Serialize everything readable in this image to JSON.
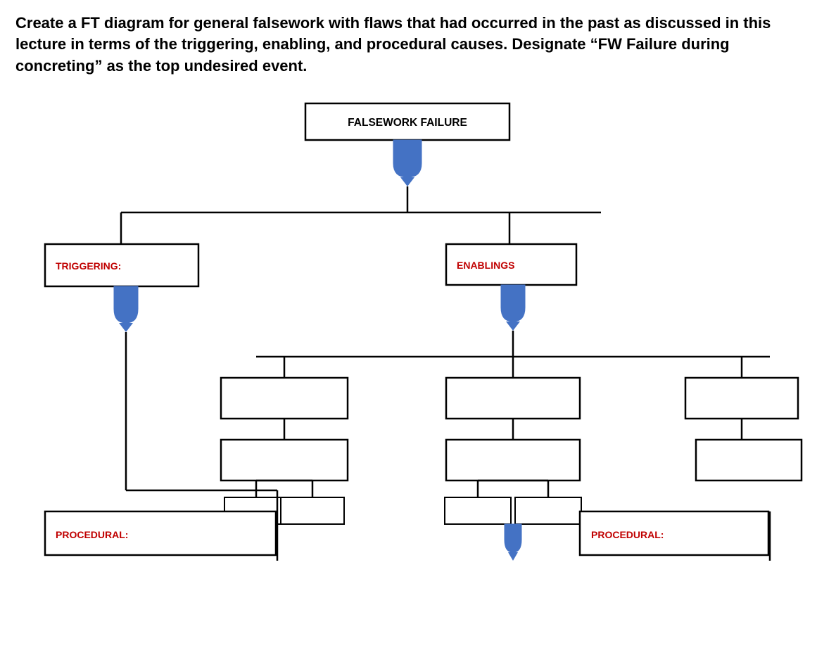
{
  "question": {
    "text": "Create a FT diagram for general falsework with flaws that had occurred in the past as discussed in this lecture in terms of the triggering, enabling, and procedural causes. Designate “FW Failure during concreting” as the top undesired event."
  },
  "diagram": {
    "top_event": "FALSEWORK FAILURE",
    "node_triggering": "TRIGGERING:",
    "node_enablings": "ENABLINGS",
    "node_procedural_left": "PROCEDURAL:",
    "node_procedural_right": "PROCEDURAL:",
    "accent_color": "#4472C4",
    "border_color": "#000",
    "label_color": "#C00000"
  }
}
